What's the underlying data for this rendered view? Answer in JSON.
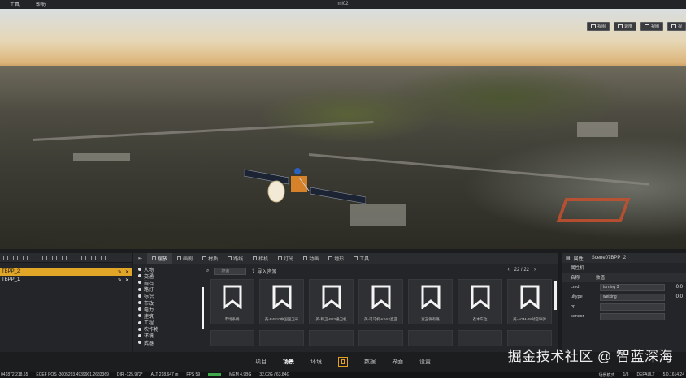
{
  "app": {
    "title": "ml02",
    "menu": [
      "工具",
      "帮助"
    ]
  },
  "view_buttons": [
    "视图",
    "速度",
    "视图",
    "视"
  ],
  "left_panel": {
    "items": [
      {
        "label": "TBPP_2",
        "selected": true
      },
      {
        "label": "TBPP_1",
        "selected": false
      }
    ]
  },
  "tabs": [
    "摆放",
    "画刷",
    "材质",
    "路线",
    "相机",
    "灯光",
    "动画",
    "地形",
    "工具"
  ],
  "categories": [
    "人物",
    "交通",
    "岩石",
    "路灯",
    "标识",
    "市政",
    "电力",
    "建筑",
    "工程",
    "农作物",
    "环境",
    "武器"
  ],
  "asset_toolbar": {
    "search_placeholder": "搜索",
    "import_label": "导入资源",
    "page": "22 / 22"
  },
  "assets": [
    {
      "label": "市场条桶"
    },
    {
      "label": "英-B4910中国国卫号"
    },
    {
      "label": "英-和卫-B33通卫机"
    },
    {
      "label": "英-司马机-KA52直亚"
    },
    {
      "label": "宽玉保有路"
    },
    {
      "label": "农木车位"
    },
    {
      "label": "英-AGM-88对空导弹"
    },
    {
      "label": ""
    },
    {
      "label": ""
    },
    {
      "label": ""
    },
    {
      "label": ""
    },
    {
      "label": ""
    },
    {
      "label": ""
    },
    {
      "label": ""
    }
  ],
  "properties": {
    "header": "属性",
    "object_name": "Scene07BPP_2",
    "subheader": "属性机",
    "columns": [
      "名称",
      "数值"
    ],
    "rows": [
      {
        "key": "cmd",
        "value": "turning 3",
        "num": "0.0"
      },
      {
        "key": "ultype",
        "value": "weixing",
        "num": "0.0"
      },
      {
        "key": "hp",
        "value": "",
        "num": ""
      },
      {
        "key": "sensor",
        "value": "",
        "num": ""
      }
    ]
  },
  "bottom_nav": {
    "items": [
      "项目",
      "场景",
      "环境",
      "数据",
      "界面",
      "设置"
    ],
    "active": "场景"
  },
  "watermark": "掘金技术社区 @ 智蓝深海",
  "status": {
    "coords": "041872.218.65",
    "ecef_label": "ECEF POS",
    "ecef_value": "-3005293.4939901.2683369",
    "dir_label": "DIR",
    "dir_value": "-125.972°",
    "alt_label": "ALT",
    "alt_value": "218.647 m",
    "fps_label": "FPS",
    "fps_value": "59",
    "mem_label": "MEM",
    "mem_value": "4.9BG",
    "mem_detail": "32.02G / 63.84G",
    "mode": "场景模式",
    "page": "1/3",
    "profile": "DEFAULT",
    "version": "5.0.1614.24"
  },
  "colors": {
    "accent": "#e1a528",
    "panel_bg": "#242528"
  }
}
